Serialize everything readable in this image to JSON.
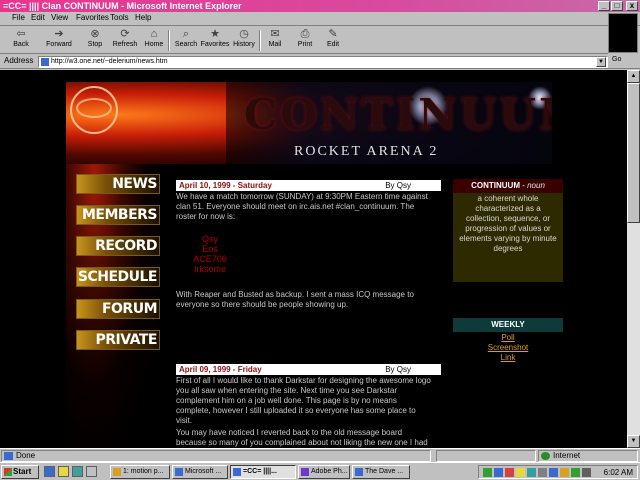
{
  "window": {
    "title": "=CC= |||| Clan CONTINUUM - Microsoft Internet Explorer",
    "minimize": "_",
    "maximize": "□",
    "close": "x"
  },
  "menu": [
    "File",
    "Edit",
    "View",
    "Favorites",
    "Tools",
    "Help"
  ],
  "toolbar": [
    {
      "label": "Back",
      "icon": "back-arrow-icon",
      "glyph": "⇦"
    },
    {
      "label": "Forward",
      "icon": "forward-arrow-icon",
      "glyph": "➔"
    },
    {
      "label": "Stop",
      "icon": "stop-icon",
      "glyph": "⊗"
    },
    {
      "label": "Refresh",
      "icon": "refresh-icon",
      "glyph": "⟳"
    },
    {
      "label": "Home",
      "icon": "home-icon",
      "glyph": "⌂"
    },
    {
      "label": "Search",
      "icon": "search-icon",
      "glyph": "⌕"
    },
    {
      "label": "Favorites",
      "icon": "favorites-icon",
      "glyph": "★"
    },
    {
      "label": "History",
      "icon": "history-icon",
      "glyph": "◷"
    },
    {
      "label": "Mail",
      "icon": "mail-icon",
      "glyph": "✉"
    },
    {
      "label": "Print",
      "icon": "print-icon",
      "glyph": "⎙"
    },
    {
      "label": "Edit",
      "icon": "edit-icon",
      "glyph": "✎"
    }
  ],
  "address": {
    "label": "Address",
    "url": "http://w3.one.net/~delerium/news.htm",
    "go": "Go"
  },
  "banner": {
    "logo": "CONTINUUM",
    "subtitle": "ROCKET ARENA 2"
  },
  "nav": [
    "NEWS",
    "MEMBERS",
    "RECORD",
    "SCHEDULE",
    "FORUM",
    "PRIVATE"
  ],
  "posts": [
    {
      "date": "April 10, 1999 - Saturday",
      "author": "By Qsy",
      "body": "We have a match tomorrow (SUNDAY) at 9:30PM Eastern time against clan 51. Everyone should meet on irc.ais.net #clan_continuum. The roster for now is:",
      "roster": [
        "Qsy",
        "Eos",
        "ACE706",
        "Irksome"
      ],
      "footer": "With Reaper and Busted as backup. I sent a mass ICQ message to everyone so there should be people showing up."
    },
    {
      "date": "April 09, 1999 - Friday",
      "author": "By Qsy",
      "body": "First of all I would like to thank Darkstar for designing the awesome logo you all saw when entering the site. Next time you see Darkstar complement him on a job well done. This page is by no means complete, however I still uploaded it so everyone has some place to visit.",
      "footer": "You may have noticed I reverted back to the old message board because so many of you complained about not liking the new one I had setup a"
    }
  ],
  "definition": {
    "word": "CONTINUUM",
    "pos": "noun",
    "text": "a coherent whole characterized as a collection, sequence, or progression of values or elements varying by minute degrees"
  },
  "weekly": {
    "title": "WEEKLY",
    "links": [
      "Poll",
      "Screenshot",
      "Link"
    ]
  },
  "status": {
    "text": "Done",
    "zone": "Internet"
  },
  "taskbar": {
    "start": "Start",
    "tasks": [
      {
        "label": "1: motion p...",
        "active": false
      },
      {
        "label": "Microsoft ...",
        "active": false
      },
      {
        "label": "=CC= ||||...",
        "active": true
      },
      {
        "label": "Adobe Ph...",
        "active": false
      },
      {
        "label": "The Dave ...",
        "active": false
      }
    ],
    "clock": "6:02 AM"
  },
  "colors": {
    "title_bar": "#e8368f",
    "post_date": "#8a1010",
    "roster": "#b00000",
    "link": "#d8a020"
  }
}
